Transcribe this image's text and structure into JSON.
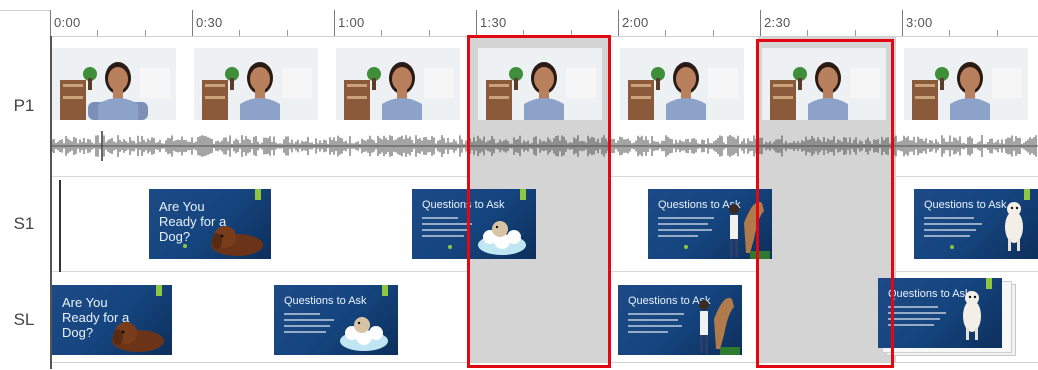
{
  "ruler": {
    "labels": [
      "0:00",
      "0:30",
      "1:00",
      "1:30",
      "2:00",
      "2:30",
      "3:00"
    ]
  },
  "tracks": {
    "p1": "P1",
    "s1": "S1",
    "sl": "SL"
  },
  "slides": {
    "dog_title": "Are You Ready for a Dog?",
    "questions_title": "Questions to Ask"
  },
  "colors": {
    "highlight": "#e30613",
    "slide_bg": "#1d4a86",
    "accent": "#8dc63f"
  }
}
